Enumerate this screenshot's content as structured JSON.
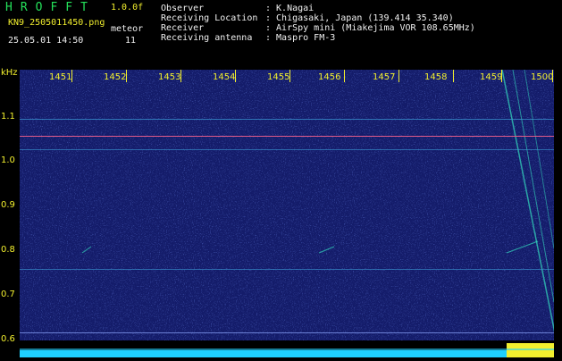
{
  "header": {
    "logo": "HROFFT",
    "version": "1.0.0f",
    "filename": "KN9_2505011450.png",
    "datetime": "25.05.01 14:50",
    "meteor_label": "meteor",
    "meteor_count": "11",
    "observer_label": "Observer",
    "observer_value": ": K.Nagai",
    "location_label": "Receiving Location",
    "location_value": ": Chigasaki, Japan (139.414 35.340)",
    "receiver_label": "Receiver",
    "receiver_value": ": AirSpy mini (Miakejima VOR 108.65MHz)",
    "antenna_label": "Receiving antenna",
    "antenna_value": ": Maspro FM-3"
  },
  "axis": {
    "unit": "kHz",
    "y_ticks": [
      "1.1",
      "1.0",
      "0.9",
      "0.8",
      "0.7",
      "0.6"
    ],
    "x_ticks": [
      "1451",
      "1452",
      "1453",
      "1454",
      "1455",
      "1456",
      "1457",
      "1458",
      "1459",
      "1500"
    ]
  },
  "colors": {
    "background": "#000000",
    "plot_bg": "#141c6a",
    "label_green": "#24e05a",
    "label_yellow": "#f2ef2e",
    "carrier_line": "#e05a8a",
    "meteor_trace": "#34e0c0"
  }
}
